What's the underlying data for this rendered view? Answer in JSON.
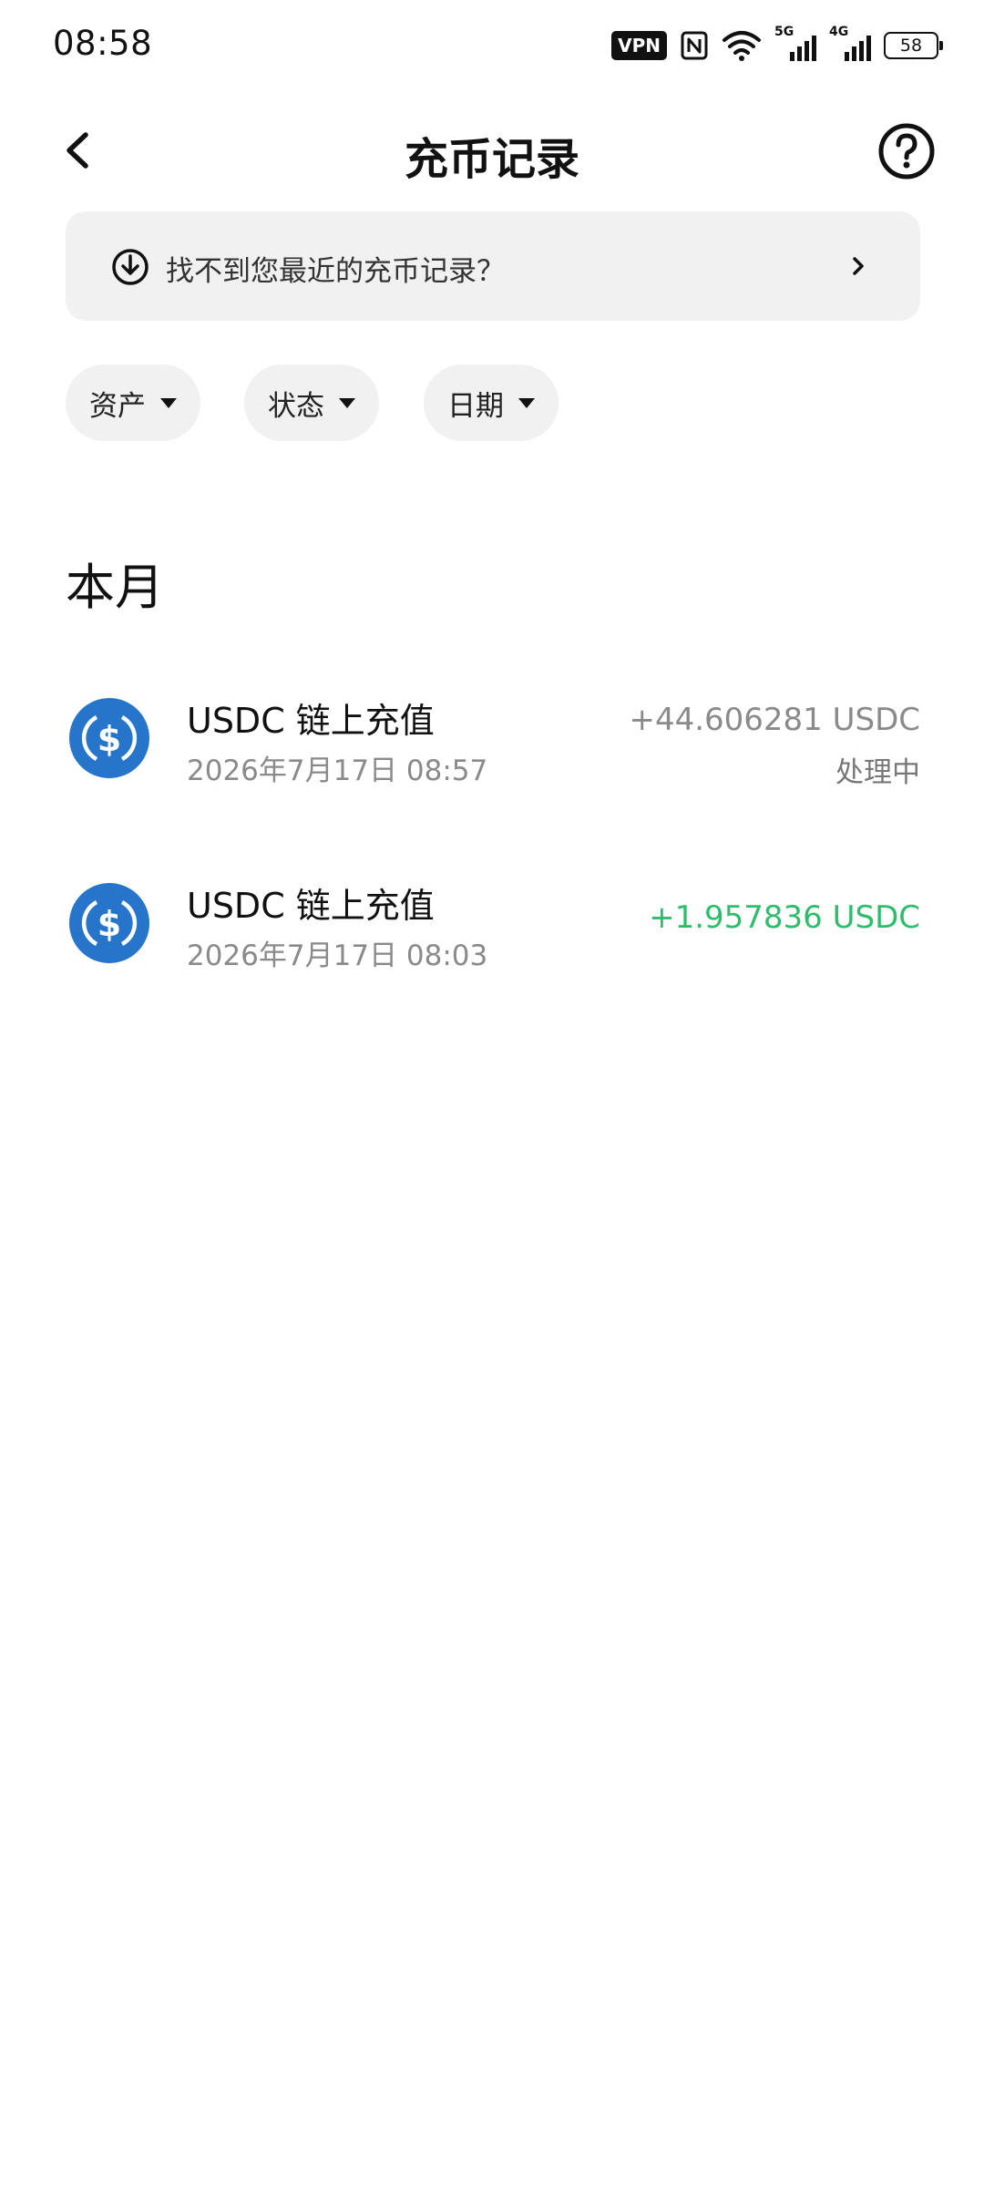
{
  "status_bar": {
    "time": "08:58",
    "vpn_label": "VPN",
    "signal_1_tag": "5G",
    "signal_2_tag": "4G",
    "battery_level": "58"
  },
  "header": {
    "title": "充币记录",
    "back_icon": "back-arrow-icon",
    "help_icon": "question-circle-icon"
  },
  "notice": {
    "text": "找不到您最近的充币记录？",
    "icon": "download-circle-icon"
  },
  "filters": [
    {
      "label": "资产"
    },
    {
      "label": "状态"
    },
    {
      "label": "日期"
    }
  ],
  "section": {
    "title": "本月"
  },
  "transactions": [
    {
      "title": "USDC 链上充值",
      "time": "2026年7月17日 08:57",
      "amount": "+44.606281 USDC",
      "status": "处理中",
      "amount_color": "#8a8a8a"
    },
    {
      "title": "USDC 链上充值",
      "time": "2026年7月17日 08:03",
      "amount": "+1.957836 USDC",
      "status": "",
      "amount_color": "#2ebd6a"
    }
  ],
  "colors": {
    "coin_blue": "#2775ca",
    "success_green": "#2ebd6a",
    "muted_gray": "#8a8a8a",
    "chip_bg": "#f1f1f1"
  }
}
